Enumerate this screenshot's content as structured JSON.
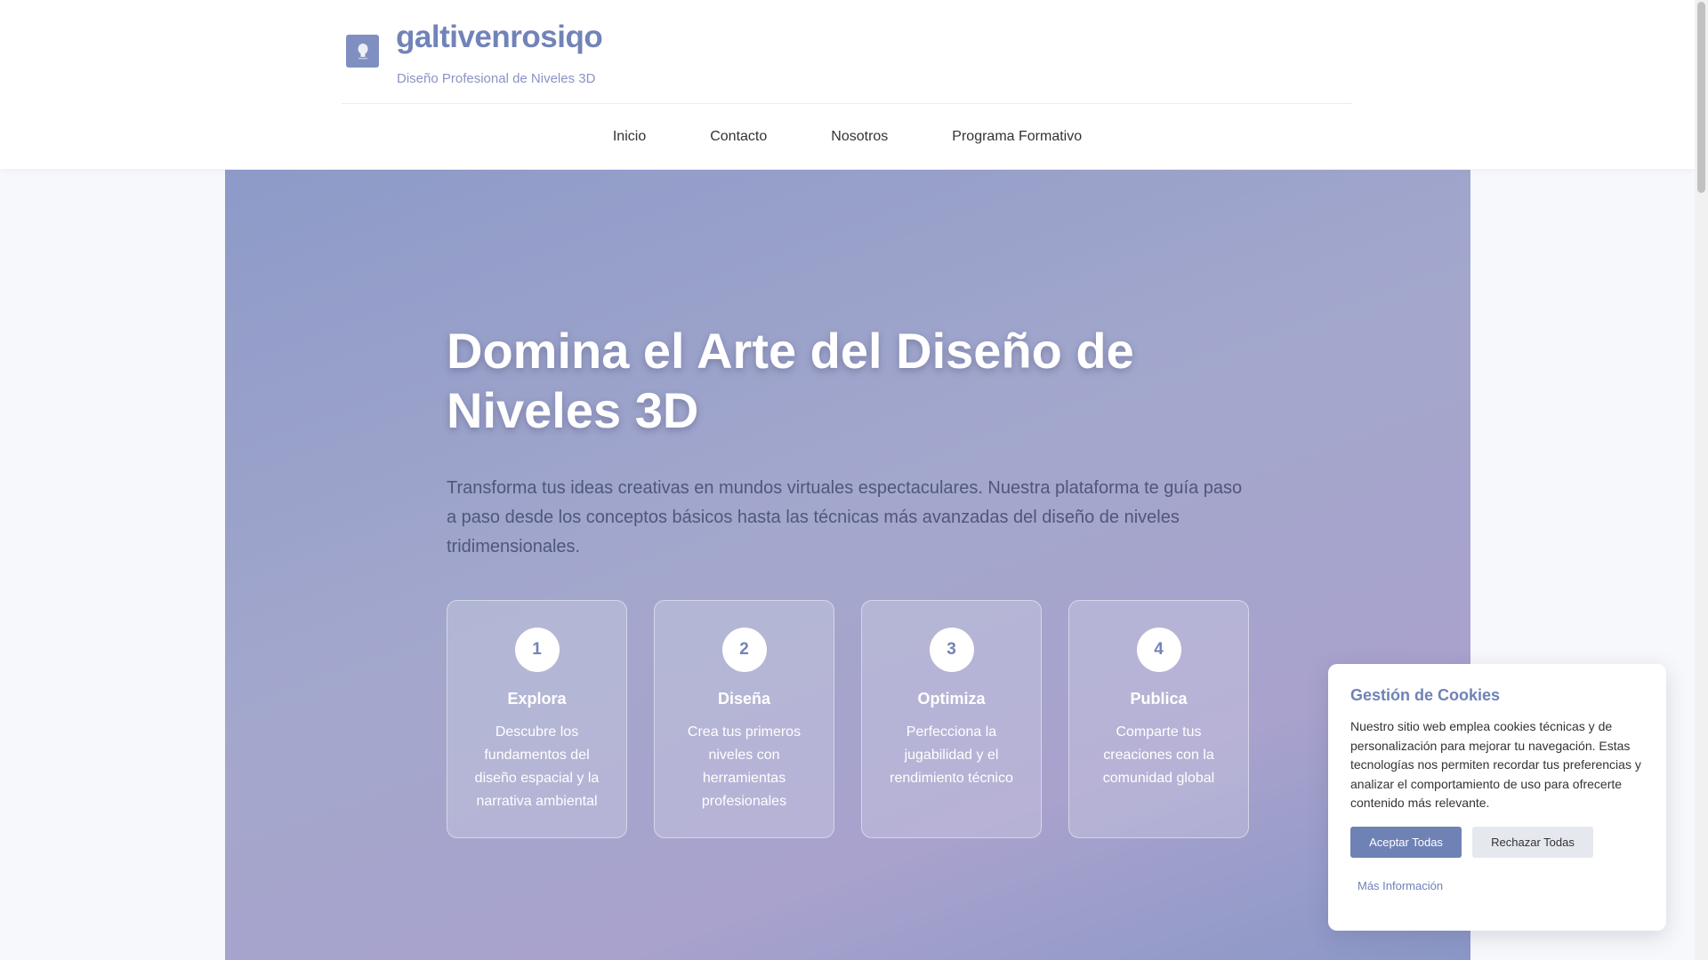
{
  "header": {
    "site_title": "galtivenrosiqo",
    "tagline": "Diseño Profesional de Niveles 3D",
    "logo_icon": "lightbulb-icon",
    "brand_color": "#7183b8"
  },
  "nav": {
    "items": [
      {
        "label": "Inicio"
      },
      {
        "label": "Contacto"
      },
      {
        "label": "Nosotros"
      },
      {
        "label": "Programa Formativo"
      }
    ]
  },
  "hero": {
    "title": "Domina el Arte del Diseño de Niveles 3D",
    "description": "Transforma tus ideas creativas en mundos virtuales espectaculares. Nuestra plataforma te guía paso a paso desde los conceptos básicos hasta las técnicas más avanzadas del diseño de niveles tridimensionales.",
    "steps": [
      {
        "number": "1",
        "title": "Explora",
        "text": "Descubre los fundamentos del diseño espacial y la narrativa ambiental"
      },
      {
        "number": "2",
        "title": "Diseña",
        "text": "Crea tus primeros niveles con herramientas profesionales"
      },
      {
        "number": "3",
        "title": "Optimiza",
        "text": "Perfecciona la jugabilidad y el rendimiento técnico"
      },
      {
        "number": "4",
        "title": "Publica",
        "text": "Comparte tus creaciones con la comunidad global"
      }
    ]
  },
  "cookies": {
    "title": "Gestión de Cookies",
    "text": "Nuestro sitio web emplea cookies técnicas y de personalización para mejorar tu navegación. Estas tecnologías nos permiten recordar tus preferencias y analizar el comportamiento de uso para ofrecerte contenido más relevante.",
    "accept_label": "Aceptar Todas",
    "reject_label": "Rechazar Todas",
    "more_label": "Más Información"
  }
}
